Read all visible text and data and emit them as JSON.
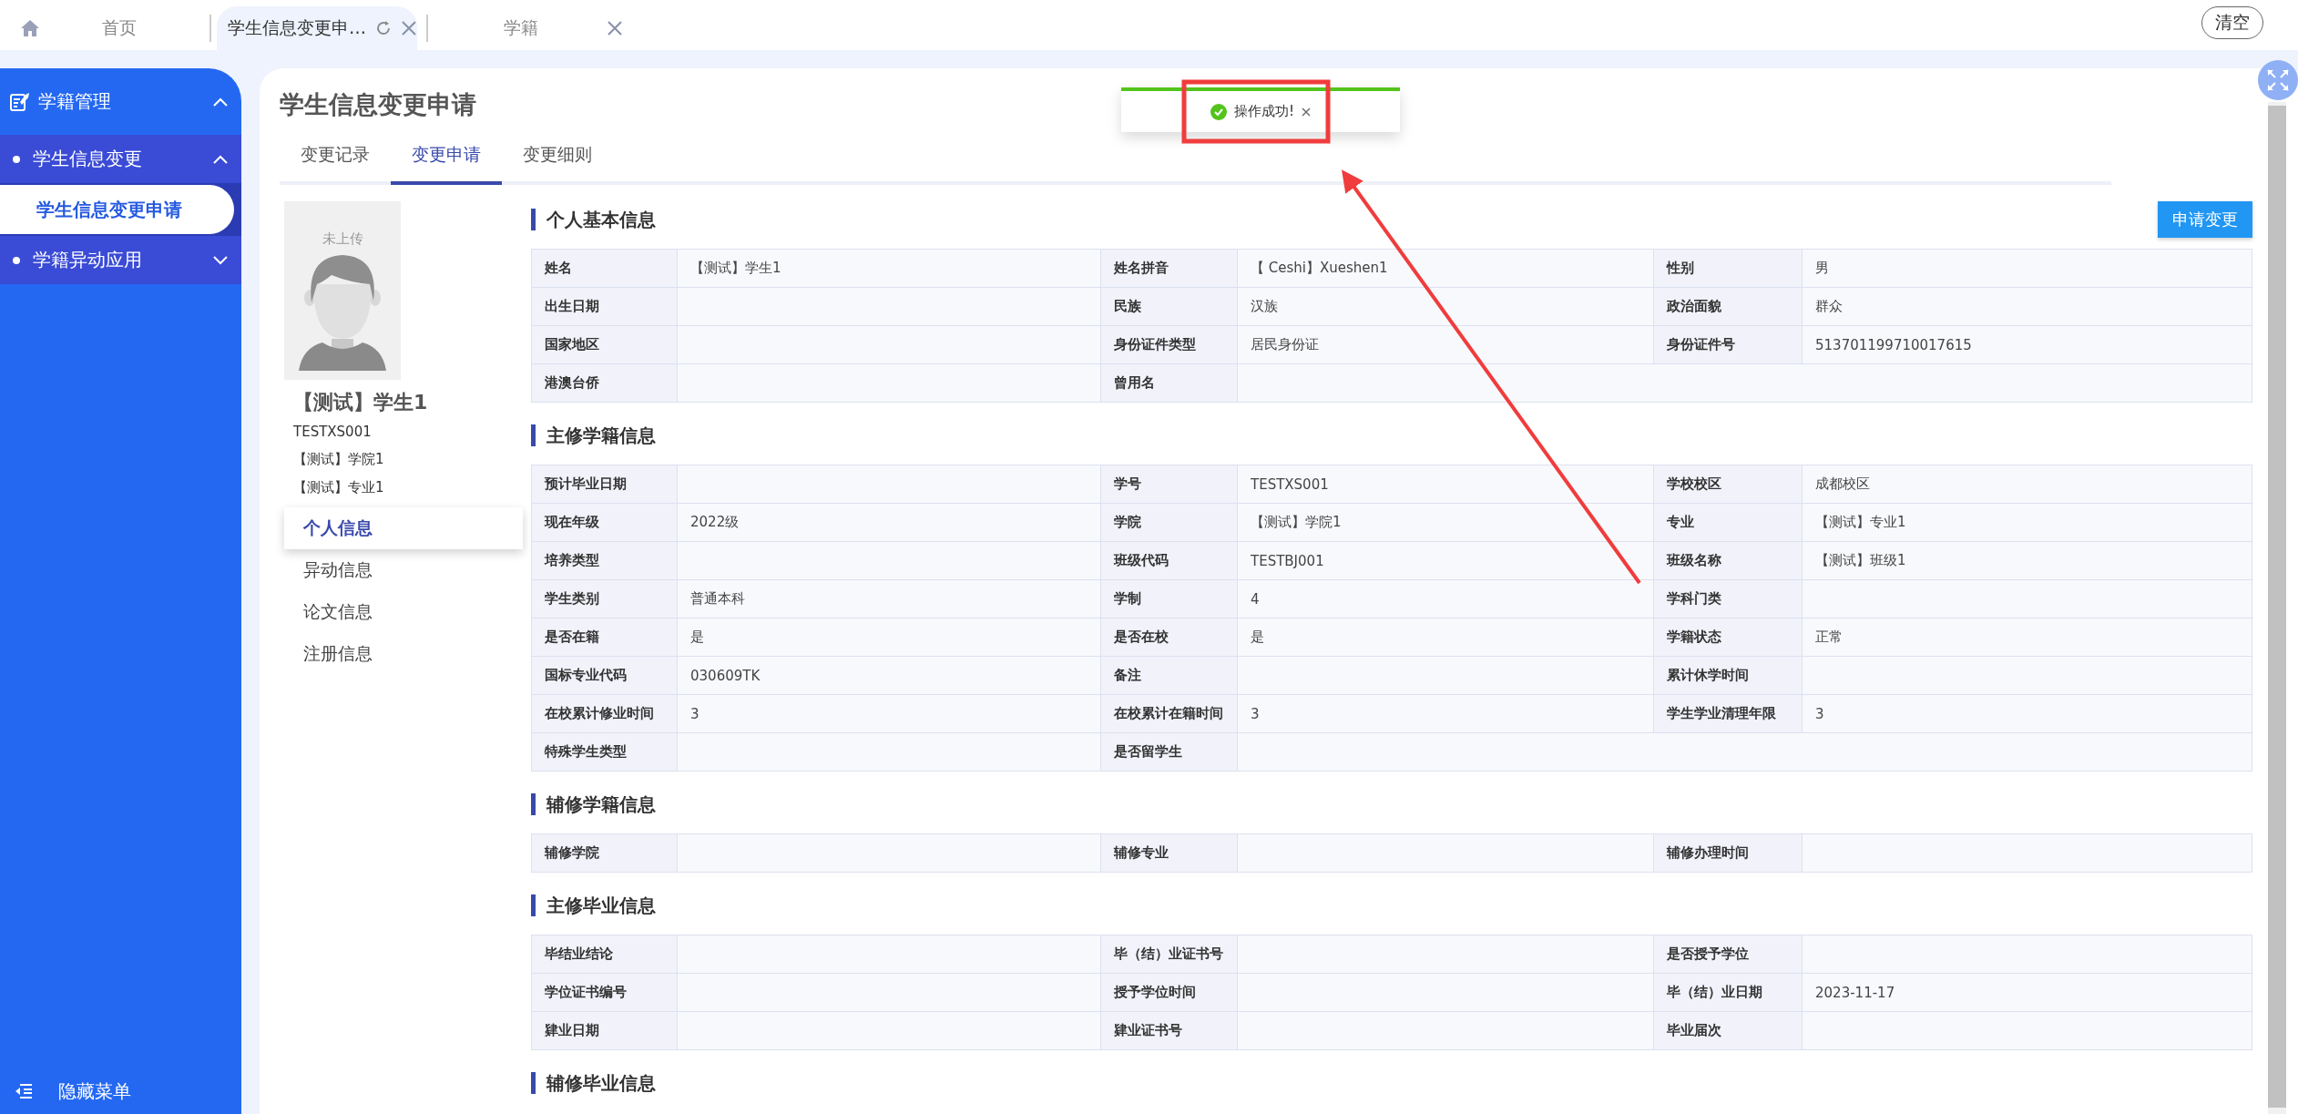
{
  "tab_bar": {
    "tabs": [
      {
        "label": "首页",
        "kind": "home",
        "selected": false,
        "closable": false
      },
      {
        "label": "学生信息变更申…",
        "kind": "page",
        "selected": true,
        "closable": true
      },
      {
        "label": "学籍",
        "kind": "page",
        "selected": false,
        "closable": true
      }
    ],
    "clear_button": "清空"
  },
  "sidebar": {
    "menu": [
      {
        "label": "学籍管理",
        "expanded": true,
        "children": [
          {
            "label": "学生信息变更",
            "expanded": true,
            "selected": false,
            "children": [
              {
                "label": "学生信息变更申请",
                "selected": true
              }
            ]
          },
          {
            "label": "学籍异动应用",
            "expanded": false,
            "selected": false
          }
        ]
      }
    ],
    "footer": "隐藏菜单"
  },
  "page_title": "学生信息变更申请",
  "tabs": [
    {
      "label": "变更记录",
      "selected": false
    },
    {
      "label": "变更申请",
      "selected": true
    },
    {
      "label": "变更细则",
      "selected": false
    }
  ],
  "profile": {
    "photo_label": "未上传",
    "name": "【测试】学生1",
    "student_id": "TESTXS001",
    "college": "【测试】学院1",
    "major": "【测试】专业1"
  },
  "profile_nav": [
    {
      "label": "个人信息",
      "selected": true
    },
    {
      "label": "异动信息",
      "selected": false
    },
    {
      "label": "论文信息",
      "selected": false
    },
    {
      "label": "注册信息",
      "selected": false
    }
  ],
  "apply_button": "申请变更",
  "sections": [
    {
      "title": "个人基本信息",
      "rows": [
        [
          {
            "label": "姓名",
            "value": "【测试】学生1"
          },
          {
            "label": "姓名拼音",
            "value": "【 Ceshi】Xueshen1"
          },
          {
            "label": "性别",
            "value": "男"
          }
        ],
        [
          {
            "label": "出生日期"
          },
          {
            "label": "民族",
            "value": "汉族"
          },
          {
            "label": "政治面貌",
            "value": "群众"
          }
        ],
        [
          {
            "label": "国家地区"
          },
          {
            "label": "身份证件类型",
            "value": "居民身份证"
          },
          {
            "label": "身份证件号",
            "value": "513701199710017615"
          }
        ],
        [
          {
            "label": "港澳台侨"
          },
          {
            "label": "曾用名"
          }
        ]
      ]
    },
    {
      "title": "主修学籍信息",
      "rows": [
        [
          {
            "label": "预计毕业日期"
          },
          {
            "label": "学号",
            "value": "TESTXS001"
          },
          {
            "label": "学校校区",
            "value": "成都校区"
          }
        ],
        [
          {
            "label": "现在年级",
            "value": "2022级"
          },
          {
            "label": "学院",
            "value": "【测试】学院1"
          },
          {
            "label": "专业",
            "value": "【测试】专业1"
          }
        ],
        [
          {
            "label": "培养类型"
          },
          {
            "label": "班级代码",
            "value": "TESTBJ001"
          },
          {
            "label": "班级名称",
            "value": "【测试】班级1"
          }
        ],
        [
          {
            "label": "学生类别",
            "value": "普通本科"
          },
          {
            "label": "学制",
            "value": "4"
          },
          {
            "label": "学科门类"
          }
        ],
        [
          {
            "label": "是否在籍",
            "value": "是"
          },
          {
            "label": "是否在校",
            "value": "是"
          },
          {
            "label": "学籍状态",
            "value": "正常"
          }
        ],
        [
          {
            "label": "国标专业代码",
            "value": "030609TK"
          },
          {
            "label": "备注"
          },
          {
            "label": "累计休学时间"
          }
        ],
        [
          {
            "label": "在校累计修业时间",
            "value": "3"
          },
          {
            "label": "在校累计在籍时间",
            "value": "3"
          },
          {
            "label": "学生学业清理年限",
            "value": "3"
          }
        ],
        [
          {
            "label": "特殊学生类型"
          },
          {
            "label": "是否留学生"
          }
        ]
      ]
    },
    {
      "title": "辅修学籍信息",
      "rows": [
        [
          {
            "label": "辅修学院"
          },
          {
            "label": "辅修专业"
          },
          {
            "label": "辅修办理时间"
          }
        ]
      ]
    },
    {
      "title": "主修毕业信息",
      "rows": [
        [
          {
            "label": "毕结业结论"
          },
          {
            "label": "毕（结）业证书号"
          },
          {
            "label": "是否授予学位"
          }
        ],
        [
          {
            "label": "学位证书编号"
          },
          {
            "label": "授予学位时间"
          },
          {
            "label": "毕（结）业日期",
            "value": "2023-11-17"
          }
        ],
        [
          {
            "label": "肄业日期"
          },
          {
            "label": "肄业证书号"
          },
          {
            "label": "毕业届次"
          }
        ]
      ]
    },
    {
      "title": "辅修毕业信息"
    }
  ],
  "toast": {
    "message": "操作成功!"
  }
}
